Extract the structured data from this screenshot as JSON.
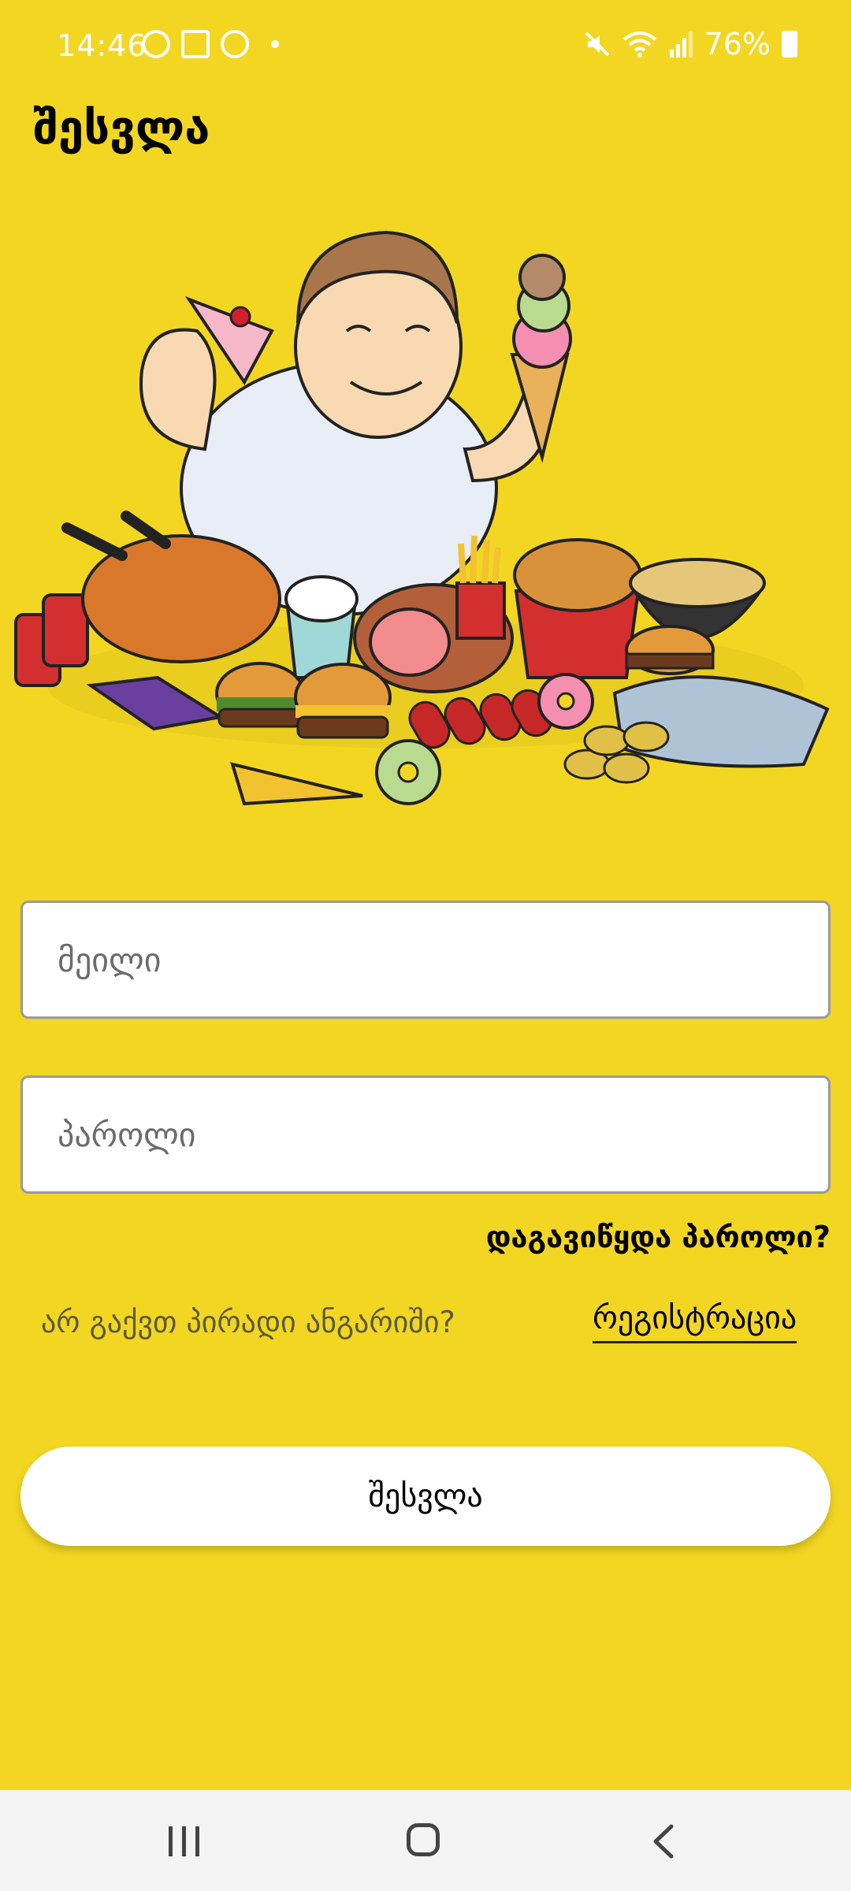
{
  "status_bar": {
    "time": "14:46",
    "battery": "76%",
    "icons": [
      "ball-notification-icon",
      "image-notification-icon",
      "ball-notification-icon",
      "mute-icon",
      "wifi-icon",
      "signal-icon",
      "battery-icon"
    ]
  },
  "header": {
    "title": "შესვლა"
  },
  "form": {
    "email_placeholder": "მეილი",
    "password_placeholder": "პაროლი",
    "forgot_password": "დაგავიწყდა პაროლი?",
    "no_account": "არ გაქვთ პირადი ანგარიში?",
    "register": "რეგისტრაცია",
    "login_button": "შესვლა"
  },
  "nav_bar": {
    "icons": [
      "recents-icon",
      "home-icon",
      "back-icon"
    ]
  },
  "colors": {
    "background": "#F3D622",
    "input_bg": "#FFFFFF",
    "button_bg": "#FFFFFF",
    "nav_bg": "#F4F4F4"
  }
}
